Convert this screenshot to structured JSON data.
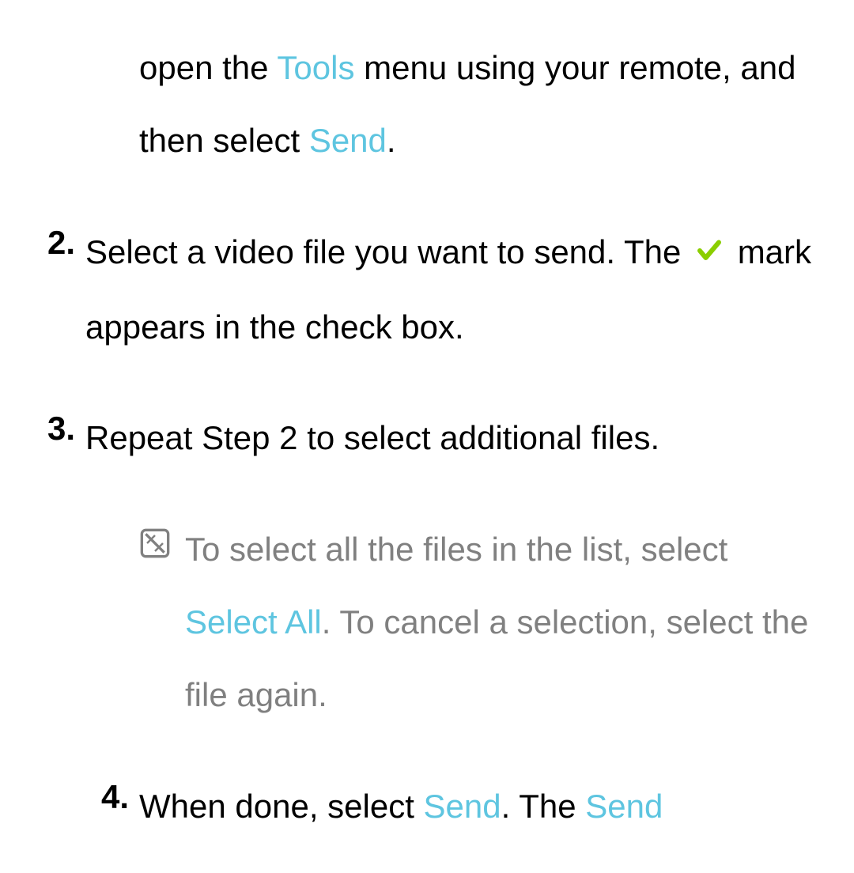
{
  "step1": {
    "part1": "open the ",
    "tools": "Tools",
    "part2": " menu using your remote, and then select ",
    "send": "Send",
    "part3": "."
  },
  "step2": {
    "num": "2.",
    "part1": "Select a video file you want to send. The ",
    "part2": " mark appears in the check box."
  },
  "step3": {
    "num": "3.",
    "text": "Repeat Step 2 to select additional files."
  },
  "note": {
    "part1": "To select all the files in the list, select ",
    "selectAll": "Select All",
    "part2": ". To cancel a selection, select the file again."
  },
  "step4": {
    "num": "4.",
    "part1": "When done, select ",
    "send1": "Send",
    "part2": ". The ",
    "send2": "Send"
  }
}
